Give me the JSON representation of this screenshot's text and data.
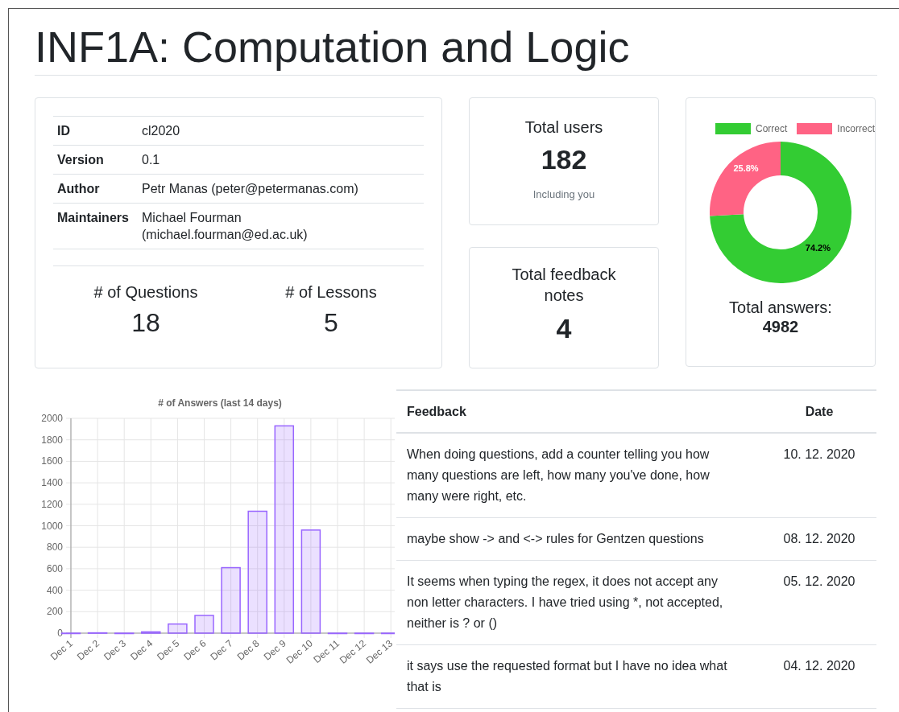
{
  "title": "INF1A: Computation and Logic",
  "info": {
    "rows": [
      {
        "label": "ID",
        "value": "cl2020"
      },
      {
        "label": "Version",
        "value": "0.1"
      },
      {
        "label": "Author",
        "value": "Petr Manas (peter@petermanas.com)"
      },
      {
        "label": "Maintainers",
        "value": "Michael Fourman (michael.fourman@ed.ac.uk)"
      }
    ],
    "stats": [
      {
        "label": "# of Questions",
        "value": "18"
      },
      {
        "label": "# of Lessons",
        "value": "5"
      }
    ]
  },
  "users_card": {
    "title": "Total users",
    "value": "182",
    "note": "Including you"
  },
  "feedback_card": {
    "title": "Total feedback notes",
    "value": "4"
  },
  "answers_card": {
    "chart_data": {
      "type": "donut",
      "categories": [
        "Correct",
        "Incorrect"
      ],
      "colors": [
        "#33cc33",
        "#ff6384"
      ],
      "values": [
        74.2,
        25.8
      ],
      "value_labels": [
        "74.2%",
        "25.8%"
      ]
    },
    "title": "Total answers:",
    "value": "4982"
  },
  "answers_chart": {
    "chart_data": {
      "type": "bar",
      "title": "# of Answers (last 14 days)",
      "categories": [
        "Dec 1",
        "Dec 2",
        "Dec 3",
        "Dec 4",
        "Dec 5",
        "Dec 6",
        "Dec 7",
        "Dec 8",
        "Dec 9",
        "Dec 10",
        "Dec 11",
        "Dec 12",
        "Dec 13"
      ],
      "color": "#9966ff",
      "values": [
        0,
        3,
        0,
        12,
        85,
        165,
        610,
        1135,
        1930,
        960,
        0,
        0,
        0
      ],
      "grid": true,
      "ylim": [
        0,
        2000
      ],
      "yticks": [
        0,
        200,
        400,
        600,
        800,
        1000,
        1200,
        1400,
        1600,
        1800,
        2000
      ]
    }
  },
  "feedback_table": {
    "columns": [
      "Feedback",
      "Date"
    ],
    "rows": [
      {
        "text": "When doing questions, add a counter telling you how many questions are left, how many you've done, how many were right, etc.",
        "date": "10. 12. 2020"
      },
      {
        "text": "maybe show -> and <-> rules for Gentzen questions",
        "date": "08. 12. 2020"
      },
      {
        "text": "It seems when typing the regex, it does not accept any non letter characters. I have tried using *, not accepted, neither is ? or ()",
        "date": "05. 12. 2020"
      },
      {
        "text": "it says use the requested format but I have no idea what that is",
        "date": "04. 12. 2020"
      }
    ]
  }
}
